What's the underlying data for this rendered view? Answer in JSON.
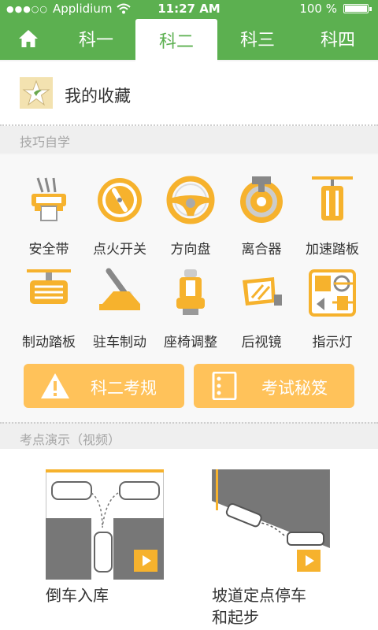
{
  "status_bar": {
    "signal": "●●●○○",
    "carrier": "Applidium",
    "time": "11:27 AM",
    "battery": "100 %"
  },
  "tabs": [
    {
      "label": "科一",
      "active": false
    },
    {
      "label": "科二",
      "active": true
    },
    {
      "label": "科三",
      "active": false
    },
    {
      "label": "科四",
      "active": false
    }
  ],
  "favorites": {
    "label": "我的收藏"
  },
  "self_study": {
    "header": "技巧自学",
    "items": [
      {
        "label": "安全带",
        "icon": "seatbelt-icon"
      },
      {
        "label": "点火开关",
        "icon": "ignition-switch-icon"
      },
      {
        "label": "方向盘",
        "icon": "steering-wheel-icon"
      },
      {
        "label": "离合器",
        "icon": "clutch-icon"
      },
      {
        "label": "加速踏板",
        "icon": "accelerator-pedal-icon"
      },
      {
        "label": "制动踏板",
        "icon": "brake-pedal-icon"
      },
      {
        "label": "驻车制动",
        "icon": "parking-brake-icon"
      },
      {
        "label": "座椅调整",
        "icon": "seat-adjust-icon"
      },
      {
        "label": "后视镜",
        "icon": "rearview-mirror-icon"
      },
      {
        "label": "指示灯",
        "icon": "indicator-lights-icon"
      }
    ]
  },
  "buttons": {
    "rules": "科二考规",
    "tips": "考试秘笈"
  },
  "videos": {
    "header": "考点演示（视频）",
    "items": [
      {
        "title": "倒车入库"
      },
      {
        "title_line1": "坡道定点停车",
        "title_line2": "和起步"
      }
    ]
  },
  "colors": {
    "brand_green": "#5cb050",
    "accent_orange": "#f6b22d",
    "button_orange": "#ffc25a"
  }
}
